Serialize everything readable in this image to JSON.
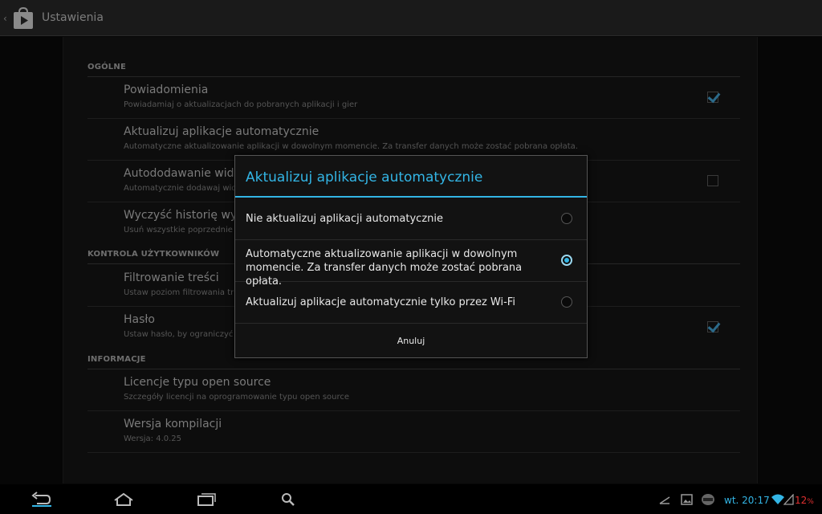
{
  "action_bar": {
    "title": "Ustawienia",
    "icon": "play-store-icon"
  },
  "settings": {
    "sections": [
      {
        "header": "OGÓLNE"
      },
      {
        "header": "KONTROLA UŻYTKOWNIKÓW"
      },
      {
        "header": "INFORMACJE"
      }
    ],
    "items": [
      {
        "title": "Powiadomienia",
        "summary": "Powiadamiaj o aktualizacjach do pobranych aplikacji i gier",
        "checked": true
      },
      {
        "title": "Aktualizuj aplikacje automatycznie",
        "summary": "Automatyczne aktualizowanie aplikacji w dowolnym momencie. Za transfer danych może zostać pobrana opłata."
      },
      {
        "title": "Autododawanie widże",
        "summary": "Automatycznie dodawaj wid",
        "checked": false
      },
      {
        "title": "Wyczyść historię wysz",
        "summary": "Usuń wszystkie poprzednie"
      },
      {
        "title": "Filtrowanie treści",
        "summary": "Ustaw poziom filtrowania tr"
      },
      {
        "title": "Hasło",
        "summary": "Ustaw hasło, by ograniczyć",
        "checked": true
      },
      {
        "title": "Licencje typu open source",
        "summary": "Szczegóły licencji na oprogramowanie typu open source"
      },
      {
        "title": "Wersja kompilacji",
        "summary": "Wersja: 4.0.25"
      }
    ]
  },
  "dialog": {
    "title": "Aktualizuj aplikacje automatycznie",
    "options": [
      {
        "label": "Nie aktualizuj aplikacji automatycznie",
        "selected": false
      },
      {
        "label": "Automatyczne aktualizowanie aplikacji w dowolnym momencie. Za transfer danych może zostać pobrana opłata.",
        "selected": true
      },
      {
        "label": "Aktualizuj aplikacje automatycznie tylko przez Wi-Fi",
        "selected": false
      }
    ],
    "cancel_label": "Anuluj"
  },
  "system_bar": {
    "clock": "wt. 20:17",
    "battery": "12",
    "nav_icons": [
      "back-icon",
      "home-icon",
      "recent-apps-icon",
      "search-icon"
    ],
    "status_icons": [
      "usb-debug-icon",
      "gallery-icon",
      "sync-icon",
      "wifi-icon",
      "signal-icon"
    ],
    "accent": "#33b5e5",
    "battery_color": "#e03030"
  }
}
